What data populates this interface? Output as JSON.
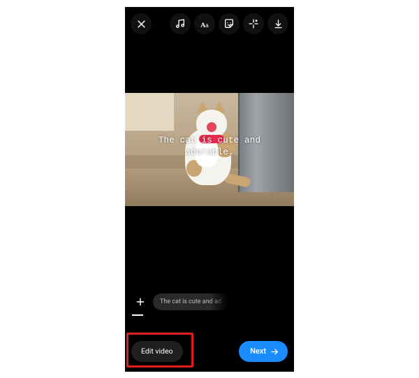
{
  "toolbar": {
    "close_icon": "close-icon",
    "music_icon": "music-icon",
    "text_icon": "text-style-icon",
    "sticker_icon": "sticker-icon",
    "effects_icon": "sparkle-icon",
    "download_icon": "download-icon"
  },
  "media": {
    "caption_overlay": "The cat is cute and\nadorable."
  },
  "strip": {
    "add_icon": "plus-icon",
    "text_preview": "The cat is cute and ad"
  },
  "bottom": {
    "edit_label": "Edit video",
    "next_label": "Next",
    "next_icon": "arrow-right-icon"
  },
  "annotation": {
    "highlight_target": "edit-video-button"
  },
  "colors": {
    "accent_blue": "#1a8cff",
    "annotation_red": "#e21b1b"
  }
}
